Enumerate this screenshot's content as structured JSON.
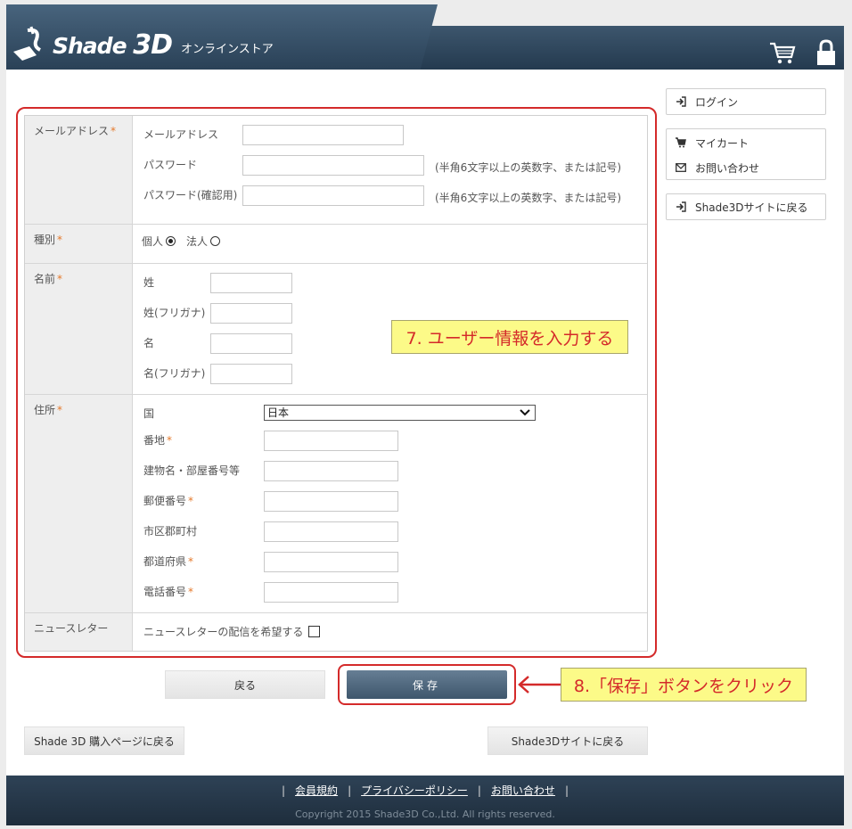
{
  "header": {
    "logo_text": "Shade",
    "logo_3d": "3D",
    "logo_sub": "オンラインストア",
    "icons": [
      "cart-icon",
      "lock-icon"
    ]
  },
  "form": {
    "account_label": "メールアドレス",
    "email_label": "メールアドレス",
    "password_label": "パスワード",
    "password_hint": "(半角6文字以上の英数字、または記号)",
    "password_confirm_label": "パスワード(確認用)",
    "password_confirm_hint": "(半角6文字以上の英数字、または記号)",
    "type_label": "種別",
    "type_personal": "個人",
    "type_corporate": "法人",
    "type_selected": "個人",
    "name_label": "名前",
    "last_name": "姓",
    "last_name_kana": "姓(フリガナ)",
    "first_name": "名",
    "first_name_kana": "名(フリガナ)",
    "address_label": "住所",
    "country_label": "国",
    "country_value": "日本",
    "street_label": "番地",
    "building_label": "建物名・部屋番号等",
    "postal_label": "郵便番号",
    "city_label": "市区郡町村",
    "prefecture_label": "都道府県",
    "phone_label": "電話番号",
    "newsletter_label": "ニュースレター",
    "newsletter_opt": "ニュースレターの配信を希望する",
    "required_mark": "*"
  },
  "buttons": {
    "back": "戻る",
    "save": "保存",
    "shop_back": "Shade 3D 購入ページに戻る",
    "site_back": "Shade3Dサイトに戻る"
  },
  "callouts": {
    "step7": "7. ユーザー情報を入力する",
    "step8": "8.「保存」ボタンをクリック"
  },
  "sidebar": {
    "login": "ログイン",
    "my_cart": "マイカート",
    "contact": "お問い合わせ",
    "site_back": "Shade3Dサイトに戻る"
  },
  "footer": {
    "links": [
      "会員規約",
      "プライバシーポリシー",
      "お問い合わせ"
    ],
    "copyright": "Copyright 2015 Shade3D Co.,Ltd. All rights reserved."
  },
  "colors": {
    "header": "#2d4458",
    "highlight": "#d42a2a",
    "callout_bg": "#fcfa88",
    "required": "#e4792b"
  }
}
